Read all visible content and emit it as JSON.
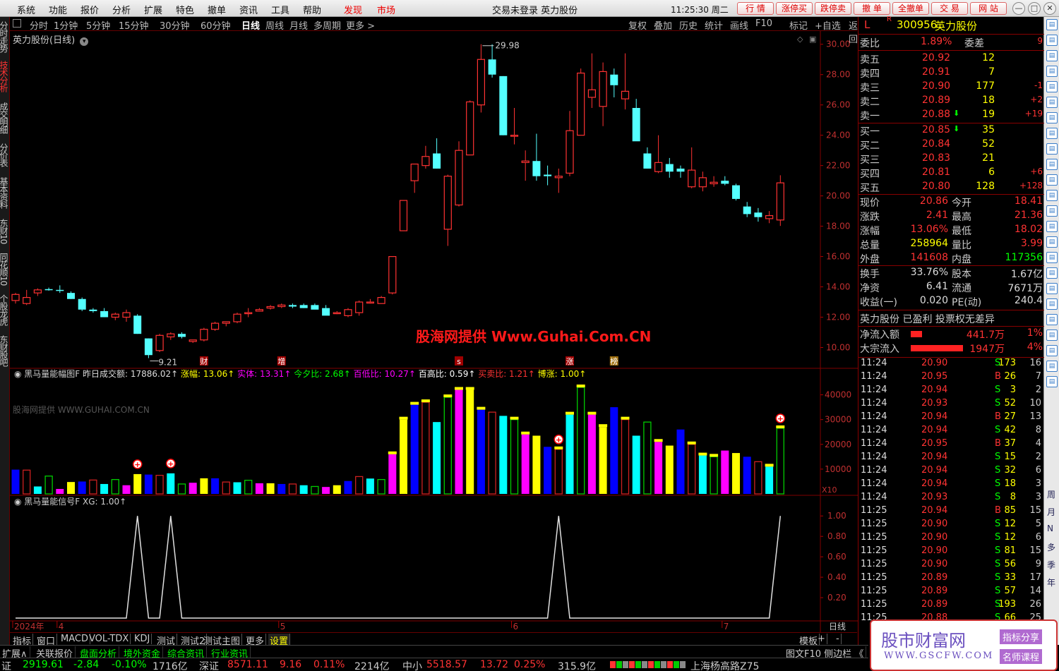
{
  "app": {
    "center_status": "交易未登录  英力股份",
    "clock": "11:25:30 周二"
  },
  "menu": [
    "系统",
    "功能",
    "报价",
    "分析",
    "扩展",
    "特色",
    "撤单",
    "资讯",
    "工具",
    "帮助"
  ],
  "menu_red": [
    "发现",
    "市场"
  ],
  "top_buttons": [
    "行  情",
    "涨停买",
    "跌停卖",
    "撤  单",
    "全撤单",
    "交  易",
    "网  站"
  ],
  "left_tabs": [
    "分时走势",
    "技术分析",
    "成交明细",
    "分价表",
    "基本资料",
    "东财10",
    "同花顺10",
    "个股龙虎",
    "东财股吧"
  ],
  "periods": [
    "分时",
    "1分钟",
    "5分钟",
    "15分钟",
    "30分钟",
    "60分钟",
    "日线",
    "周线",
    "月线",
    "多周期",
    "更多 >"
  ],
  "selected_period": "日线",
  "chart_tools": [
    "复权",
    "叠加",
    "历史",
    "统计",
    "画线",
    "F10",
    "标记",
    "+自选",
    "返回"
  ],
  "chart_title": "英力股份(日线)",
  "watermark": "股海网提供 Www.Guhai.Com.CN",
  "watermark_small": "股海网提供 WWW.GUHAI.COM.CN",
  "price_axis": [
    "30.00",
    "28.00",
    "26.00",
    "24.00",
    "22.00",
    "20.00",
    "18.00",
    "16.00",
    "14.00",
    "12.00",
    "10.00"
  ],
  "high_label": "29.98",
  "low_label": "9.21",
  "event_marks": [
    "财",
    "增",
    "s",
    "涨",
    "榜"
  ],
  "ind1": {
    "name": "黑马量能幅图F",
    "items": [
      {
        "k": "昨日成交额:",
        "v": "17886.02",
        "c": "#ddd"
      },
      {
        "k": "涨幅:",
        "v": "13.06",
        "c": "#ff0"
      },
      {
        "k": "实体:",
        "v": "13.31",
        "c": "#f0f"
      },
      {
        "k": "今夕比:",
        "v": "2.68",
        "c": "#0f0"
      },
      {
        "k": "百低比:",
        "v": "10.27",
        "c": "#f0f"
      },
      {
        "k": "百高比:",
        "v": "0.59",
        "c": "#fff"
      },
      {
        "k": "买卖比:",
        "v": "1.21",
        "c": "#f33"
      },
      {
        "k": "博涨:",
        "v": "1.00",
        "c": "#ff0"
      }
    ],
    "axis": [
      "40000",
      "30000",
      "20000",
      "10000"
    ],
    "unit": "X10"
  },
  "ind2": {
    "name": "黑马量能信号F",
    "label": "XG:",
    "value": "1.00",
    "axis": [
      "1.00",
      "0.80",
      "0.60",
      "0.40",
      "0.20"
    ]
  },
  "date_axis": [
    "2024年",
    "4",
    "5",
    "6",
    "7"
  ],
  "date_axis_right": "日线",
  "bottom_tabs": [
    "指标",
    "窗口",
    "MACD",
    "VOL-TDX",
    "KDJ",
    "测试",
    "测试2",
    "测试主图",
    "更多",
    "设置"
  ],
  "bottom_tabs_right": [
    "模板",
    "+",
    "-"
  ],
  "row2": [
    {
      "t": "扩展∧",
      "c": "#ccc"
    },
    {
      "t": "关联报价",
      "c": "#ccc"
    },
    {
      "t": "盘面分析",
      "c": "#0f0"
    },
    {
      "t": "境外资金",
      "c": "#0f0"
    },
    {
      "t": "综合资讯",
      "c": "#0f0"
    },
    {
      "t": "行业资讯",
      "c": "#0f0"
    }
  ],
  "row2_right": "图文F10 侧边栏 《",
  "status": [
    {
      "t": "证",
      "c": "#ccc"
    },
    {
      "t": "2919.61",
      "c": "#0f0"
    },
    {
      "t": "-2.84",
      "c": "#0f0"
    },
    {
      "t": "-0.10%",
      "c": "#0f0"
    },
    {
      "t": "1716亿",
      "c": "#ccc"
    },
    {
      "t": "深证",
      "c": "#ccc"
    },
    {
      "t": "8571.11",
      "c": "#f33"
    },
    {
      "t": "9.16",
      "c": "#f33"
    },
    {
      "t": "0.11%",
      "c": "#f33"
    },
    {
      "t": "2214亿",
      "c": "#ccc"
    },
    {
      "t": "中小",
      "c": "#ccc"
    },
    {
      "t": "5518.57",
      "c": "#f33"
    },
    {
      "t": "13.72",
      "c": "#f33"
    },
    {
      "t": "0.25%",
      "c": "#f33"
    },
    {
      "t": "315.9亿",
      "c": "#ccc"
    },
    {
      "t": "上海杨高路Z75",
      "c": "#ccc"
    }
  ],
  "stock": {
    "code": "300956",
    "name": "英力股份",
    "prefix": "L",
    "badge": "R"
  },
  "weibi": {
    "label": "委比",
    "v1": "1.89%",
    "label2": "委差",
    "v3": "9"
  },
  "asks": [
    {
      "l": "卖五",
      "p": "20.92",
      "v": "12",
      "c": ""
    },
    {
      "l": "卖四",
      "p": "20.91",
      "v": "7",
      "c": ""
    },
    {
      "l": "卖三",
      "p": "20.90",
      "v": "177",
      "c": "-1"
    },
    {
      "l": "卖二",
      "p": "20.89",
      "v": "18",
      "c": "+2"
    },
    {
      "l": "卖一",
      "p": "20.88",
      "v": "19",
      "c": "+19"
    }
  ],
  "bids": [
    {
      "l": "买一",
      "p": "20.85",
      "v": "35",
      "c": ""
    },
    {
      "l": "买二",
      "p": "20.84",
      "v": "52",
      "c": ""
    },
    {
      "l": "买三",
      "p": "20.83",
      "v": "21",
      "c": ""
    },
    {
      "l": "买四",
      "p": "20.81",
      "v": "6",
      "c": "+6"
    },
    {
      "l": "买五",
      "p": "20.80",
      "v": "128",
      "c": "+128"
    }
  ],
  "quote": [
    {
      "l1": "现价",
      "v1": "20.86",
      "l2": "今开",
      "v2": "18.41",
      "c1": "#f33",
      "c2": "#f33"
    },
    {
      "l1": "涨跌",
      "v1": "2.41",
      "l2": "最高",
      "v2": "21.36",
      "c1": "#f33",
      "c2": "#f33"
    },
    {
      "l1": "涨幅",
      "v1": "13.06%",
      "l2": "最低",
      "v2": "18.02",
      "c1": "#f33",
      "c2": "#f33"
    },
    {
      "l1": "总量",
      "v1": "258964",
      "l2": "量比",
      "v2": "3.99",
      "c1": "#ff0",
      "c2": "#f33"
    },
    {
      "l1": "外盘",
      "v1": "141608",
      "l2": "内盘",
      "v2": "117356",
      "c1": "#f33",
      "c2": "#0f0"
    }
  ],
  "finance": [
    {
      "l1": "换手",
      "v1": "33.76%",
      "l2": "股本",
      "v2": "1.67亿"
    },
    {
      "l1": "净资",
      "v1": "6.41",
      "l2": "流通",
      "v2": "7671万"
    },
    {
      "l1": "收益(一)",
      "v1": "0.020",
      "l2": "PE(动)",
      "v2": "240.4"
    }
  ],
  "tagline": "英力股份 已盈利 投票权无差异",
  "flows": [
    {
      "l": "净流入额",
      "v": "441.7万",
      "p": "1%"
    },
    {
      "l": "大宗流入",
      "v": "1947万",
      "p": "4%"
    }
  ],
  "ticks": [
    [
      "11:24",
      "20.90",
      "173",
      "S",
      "16"
    ],
    [
      "11:24",
      "20.95",
      "26",
      "B",
      "7"
    ],
    [
      "11:24",
      "20.94",
      "3",
      "S",
      "2"
    ],
    [
      "11:24",
      "20.93",
      "52",
      "S",
      "10"
    ],
    [
      "11:24",
      "20.94",
      "27",
      "B",
      "13"
    ],
    [
      "11:24",
      "20.94",
      "42",
      "S",
      "8"
    ],
    [
      "11:24",
      "20.95",
      "37",
      "B",
      "4"
    ],
    [
      "11:24",
      "20.94",
      "15",
      "S",
      "2"
    ],
    [
      "11:24",
      "20.94",
      "32",
      "S",
      "6"
    ],
    [
      "11:24",
      "20.94",
      "18",
      "S",
      "3"
    ],
    [
      "11:24",
      "20.93",
      "8",
      "S",
      "3"
    ],
    [
      "11:25",
      "20.94",
      "85",
      "B",
      "15"
    ],
    [
      "11:25",
      "20.90",
      "12",
      "S",
      "5"
    ],
    [
      "11:25",
      "20.90",
      "12",
      "S",
      "6"
    ],
    [
      "11:25",
      "20.90",
      "81",
      "S",
      "15"
    ],
    [
      "11:25",
      "20.90",
      "56",
      "S",
      "9"
    ],
    [
      "11:25",
      "20.89",
      "33",
      "S",
      "17"
    ],
    [
      "11:25",
      "20.89",
      "57",
      "S",
      "14"
    ],
    [
      "11:25",
      "20.89",
      "193",
      "S",
      "26"
    ],
    [
      "11:25",
      "20.88",
      "66",
      "S",
      "25"
    ]
  ],
  "right_side_labels": [
    "周",
    "月",
    "N",
    "多",
    "季",
    "年"
  ],
  "logo": {
    "title": "股市财富网",
    "sub": "WWW.GSCFW.COM",
    "tag1": "指标分享",
    "tag2": "名师课程"
  },
  "colors": {
    "up": "#ff3232",
    "down": "#54ffff",
    "frame": "#800000",
    "accent": "#ff0000"
  },
  "chart_data": {
    "type": "candlestick",
    "ylim": [
      9,
      30.5
    ],
    "candles": [
      [
        13.1,
        13.6,
        12.9,
        13.5
      ],
      [
        12.9,
        13.8,
        12.8,
        13.3
      ],
      [
        13.6,
        13.9,
        13.4,
        13.8
      ],
      [
        13.85,
        13.95,
        13.75,
        13.8
      ],
      [
        13.8,
        14.1,
        13.6,
        13.75
      ],
      [
        13.6,
        13.7,
        13.2,
        13.2
      ],
      [
        13.2,
        13.3,
        12.4,
        12.5
      ],
      [
        12.5,
        12.6,
        12.3,
        12.4
      ],
      [
        12.4,
        12.6,
        12.0,
        12.0
      ],
      [
        12.0,
        12.3,
        11.8,
        12.2
      ],
      [
        12.0,
        12.5,
        11.7,
        12.3
      ],
      [
        12.1,
        12.2,
        10.9,
        10.9
      ],
      [
        10.6,
        10.6,
        9.3,
        9.5
      ],
      [
        9.8,
        10.9,
        9.7,
        10.8
      ],
      [
        10.7,
        11.0,
        10.5,
        10.9
      ],
      [
        10.9,
        11.0,
        10.6,
        10.7
      ],
      [
        10.4,
        10.5,
        10.3,
        10.5
      ],
      [
        10.5,
        11.3,
        10.4,
        11.2
      ],
      [
        11.2,
        11.7,
        11.1,
        11.6
      ],
      [
        11.6,
        11.7,
        11.4,
        11.7
      ],
      [
        11.7,
        12.3,
        11.6,
        12.2
      ],
      [
        12.3,
        12.6,
        12.0,
        12.3
      ],
      [
        12.4,
        12.6,
        12.4,
        12.5
      ],
      [
        12.6,
        12.8,
        12.5,
        12.7
      ],
      [
        12.7,
        12.9,
        12.6,
        12.8
      ],
      [
        12.8,
        12.9,
        12.6,
        12.7
      ],
      [
        12.8,
        12.9,
        12.6,
        12.6
      ],
      [
        12.8,
        12.9,
        12.6,
        12.5
      ],
      [
        12.6,
        12.8,
        12.4,
        12.1
      ],
      [
        12.3,
        12.4,
        12.2,
        12.3
      ],
      [
        12.1,
        12.6,
        12.0,
        12.5
      ],
      [
        12.3,
        13.1,
        12.1,
        13.0
      ],
      [
        13.0,
        13.2,
        12.9,
        13.0
      ],
      [
        12.9,
        13.4,
        12.9,
        13.3
      ],
      [
        13.6,
        16.0,
        13.5,
        16.0
      ],
      [
        17.7,
        19.7,
        17.7,
        19.7
      ],
      [
        21.0,
        21.3,
        20.2,
        22.1
      ],
      [
        22.0,
        23.3,
        21.8,
        22.6
      ],
      [
        22.8,
        23.8,
        21.8,
        21.8
      ],
      [
        17.8,
        21.4,
        16.7,
        21.3
      ],
      [
        19.4,
        23.6,
        19.3,
        23.0
      ],
      [
        22.7,
        26.3,
        22.7,
        26.2
      ],
      [
        26.0,
        30.0,
        25.5,
        29.0
      ],
      [
        29.0,
        30.0,
        27.8,
        28.0
      ],
      [
        27.9,
        27.9,
        24.0,
        24.0
      ],
      [
        24.0,
        25.8,
        23.4,
        24.0
      ],
      [
        22.2,
        23.0,
        21.0,
        22.3
      ],
      [
        22.3,
        24.1,
        21.0,
        21.3
      ],
      [
        21.4,
        22.0,
        20.7,
        21.3
      ],
      [
        21.2,
        21.8,
        20.2,
        21.3
      ],
      [
        21.5,
        25.6,
        21.3,
        24.3
      ],
      [
        24.0,
        28.4,
        24.0,
        28.1
      ],
      [
        26.5,
        29.4,
        25.8,
        27.0
      ],
      [
        25.9,
        28.8,
        24.6,
        28.2
      ],
      [
        28.0,
        28.4,
        26.5,
        27.3
      ],
      [
        26.4,
        29.4,
        25.7,
        26.9
      ],
      [
        25.8,
        26.4,
        23.8,
        23.6
      ],
      [
        22.8,
        23.2,
        21.8,
        21.8
      ],
      [
        21.6,
        24.0,
        21.5,
        22.2
      ],
      [
        22.1,
        22.5,
        21.2,
        21.6
      ],
      [
        21.8,
        22.0,
        21.2,
        21.6
      ],
      [
        20.6,
        23.2,
        20.5,
        21.7
      ],
      [
        20.6,
        21.6,
        20.3,
        21.2
      ],
      [
        20.8,
        21.3,
        20.6,
        20.9
      ],
      [
        21.0,
        21.3,
        20.7,
        20.8
      ],
      [
        20.7,
        20.8,
        19.7,
        19.8
      ],
      [
        19.3,
        19.6,
        18.6,
        18.8
      ],
      [
        18.9,
        19.2,
        18.3,
        18.6
      ],
      [
        18.5,
        19.0,
        18.2,
        18.7
      ],
      [
        18.41,
        21.36,
        18.02,
        20.86
      ]
    ],
    "volume": {
      "ylim": [
        0,
        45000
      ],
      "values": [
        9800,
        9600,
        3000,
        7200,
        2000,
        4800,
        5000,
        5600,
        4000,
        5800,
        3500,
        8000,
        7800,
        7500,
        8300,
        4000,
        4500,
        6300,
        6300,
        4800,
        4700,
        5500,
        4300,
        4300,
        4000,
        4000,
        3500,
        3000,
        2800,
        3500,
        5200,
        7000,
        6200,
        5800,
        16000,
        30000,
        36000,
        37000,
        29000,
        39000,
        42000,
        42000,
        34000,
        33000,
        31500,
        30000,
        24000,
        23500,
        19000,
        18000,
        32000,
        43000,
        32000,
        27000,
        35000,
        30000,
        23500,
        29000,
        21000,
        19500,
        26000,
        20000,
        15500,
        15000,
        17500,
        16500,
        15000,
        13000,
        11000,
        26500
      ],
      "signal_days": [
        11,
        14,
        49,
        69
      ]
    },
    "signal": {
      "ylim": [
        0,
        1.05
      ],
      "values": [
        0,
        0,
        0,
        0,
        0,
        0,
        0,
        0,
        0,
        0,
        0,
        1,
        0,
        0,
        1,
        0,
        0,
        0,
        0,
        0,
        0,
        0,
        0,
        0,
        0,
        0,
        0,
        0,
        0,
        0,
        0,
        0,
        0,
        0,
        0,
        0,
        0,
        0,
        0,
        0,
        0,
        0,
        0,
        0,
        0,
        0,
        0,
        0,
        0,
        1,
        0,
        0,
        0,
        0,
        0,
        0,
        0,
        0,
        0,
        0,
        0,
        0,
        0,
        0,
        0,
        0,
        0,
        0,
        0,
        1
      ]
    }
  }
}
